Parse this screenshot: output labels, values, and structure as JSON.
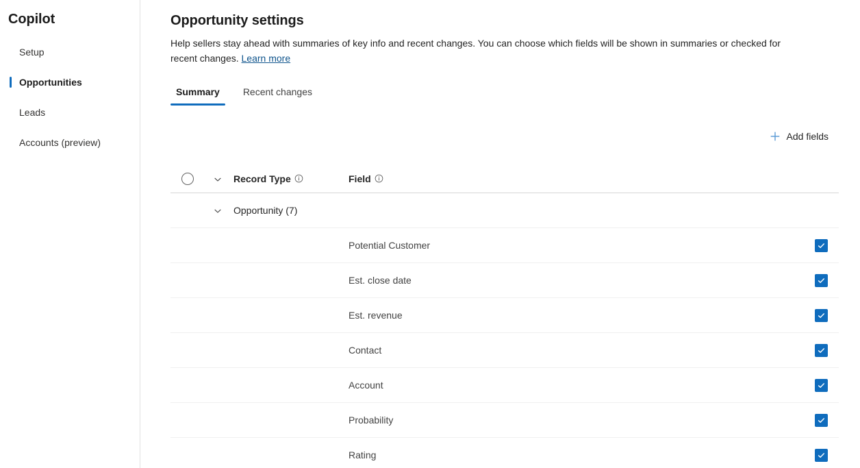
{
  "sidebar": {
    "title": "Copilot",
    "items": [
      {
        "label": "Setup",
        "active": false
      },
      {
        "label": "Opportunities",
        "active": true
      },
      {
        "label": "Leads",
        "active": false
      },
      {
        "label": "Accounts (preview)",
        "active": false
      }
    ]
  },
  "main": {
    "page_title": "Opportunity settings",
    "description": "Help sellers stay ahead with summaries of key info and recent changes. You can choose which fields will be shown in summaries or checked for recent changes.",
    "learn_more_label": "Learn more",
    "tabs": [
      {
        "label": "Summary",
        "selected": true
      },
      {
        "label": "Recent changes",
        "selected": false
      }
    ],
    "commandbar": {
      "add_fields_label": "Add fields",
      "add_fields_icon": "plus-icon"
    },
    "table": {
      "select_all_icon": "circle-unchecked-icon",
      "expand_all_icon": "chevron-down-icon",
      "columns": [
        {
          "label": "Record Type",
          "info_icon": "info-icon"
        },
        {
          "label": "Field",
          "info_icon": "info-icon"
        }
      ],
      "group": {
        "label": "Opportunity (7)",
        "expand_icon": "chevron-down-icon"
      },
      "rows": [
        {
          "field": "Potential Customer",
          "checked": true
        },
        {
          "field": "Est. close date",
          "checked": true
        },
        {
          "field": "Est. revenue",
          "checked": true
        },
        {
          "field": "Contact",
          "checked": true
        },
        {
          "field": "Account",
          "checked": true
        },
        {
          "field": "Probability",
          "checked": true
        },
        {
          "field": "Rating",
          "checked": true
        }
      ]
    }
  },
  "colors": {
    "accent": "#0f6cbd",
    "link": "#0f548c",
    "plus_icon": "#5b9bd5",
    "border": "#e1e1e1",
    "row_divider": "#f0f0f0"
  }
}
